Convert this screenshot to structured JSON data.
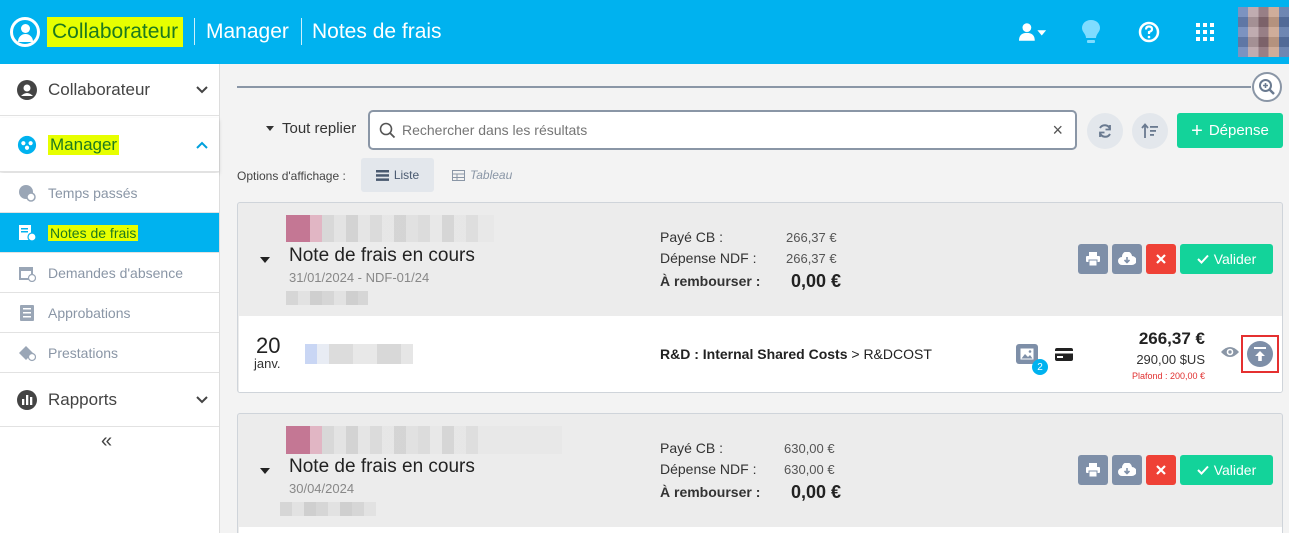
{
  "topbar": {
    "crumb_collab": "Collaborateur",
    "crumb_manager": "Manager",
    "crumb_notes": "Notes de frais",
    "icons": [
      "user-switch-icon",
      "lightbulb-icon",
      "help-icon",
      "apps-grid-icon"
    ],
    "accent": "#00b2ef"
  },
  "sidebar": {
    "collab": "Collaborateur",
    "manager": "Manager",
    "temps": "Temps passés",
    "notes": "Notes de frais",
    "absence": "Demandes d'absence",
    "approbations": "Approbations",
    "prestations": "Prestations",
    "rapports": "Rapports",
    "collapse": "«"
  },
  "toolbar": {
    "collapse_all": "Tout replier",
    "search_placeholder": "Rechercher dans les résultats",
    "add_label": "Dépense",
    "display_options": "Options d'affichage :",
    "view_list": "Liste",
    "view_table": "Tableau"
  },
  "reports": [
    {
      "title": "Note de frais en cours",
      "subtitle": "31/01/2024 - NDF-01/24",
      "paid_cb_label": "Payé CB :",
      "paid_cb": "266,37 €",
      "ndf_label": "Dépense NDF :",
      "ndf": "266,37 €",
      "refund_label": "À rembourser :",
      "refund": "0,00 €",
      "validate": "Valider",
      "line": {
        "day": "20",
        "month": "janv.",
        "category": "R&D : Internal Shared Costs",
        "subcategory": "> R&DCOST",
        "attachments": "2",
        "amount": "266,37 €",
        "amount_foreign": "290,00 $US",
        "ceiling": "Plafond : 200,00 €"
      }
    },
    {
      "title": "Note de frais en cours",
      "subtitle": "30/04/2024",
      "paid_cb_label": "Payé CB :",
      "paid_cb": "630,00 €",
      "ndf_label": "Dépense NDF :",
      "ndf": "630,00 €",
      "refund_label": "À rembourser :",
      "refund": "0,00 €",
      "validate": "Valider"
    }
  ]
}
